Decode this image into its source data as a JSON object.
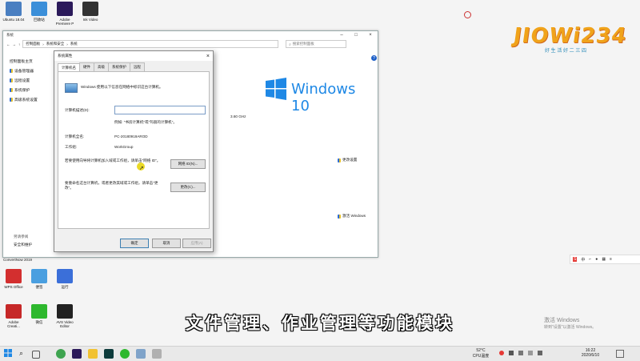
{
  "desktop": {
    "icons_top": [
      {
        "label": "Ubuntu 18.04",
        "color": "#4a7fc1"
      },
      {
        "label": "回收站",
        "color": "#3b8fd9"
      },
      {
        "label": "Adobe Premiere P",
        "color": "#2b1a5a"
      },
      {
        "label": "Ink Video",
        "color": "#333"
      }
    ],
    "icons_mid_label": "ConvertNow 2019",
    "icons_row2": [
      {
        "label": "WPS Office",
        "color": "#d32f2f"
      },
      {
        "label": "便签",
        "color": "#4a9fe0"
      },
      {
        "label": "运行",
        "color": "#3b6fd9"
      }
    ],
    "icons_row3": [
      {
        "label": "Adobe Creati...",
        "color": "#c62828"
      },
      {
        "label": "微信",
        "color": "#2eb82e"
      },
      {
        "label": "AVS Video Editor",
        "color": "#222"
      }
    ]
  },
  "explorer": {
    "title": "系统",
    "breadcrumb": [
      "控制面板",
      "系统和安全",
      "系统"
    ],
    "search_placeholder": "搜索控制面板",
    "sidebar": {
      "home": "控制面板主页",
      "items": [
        "设备管理器",
        "远程设置",
        "系统保护",
        "高级系统设置"
      ],
      "see_also": "另请参阅",
      "security": "安全和维护"
    },
    "brand": "Windows 10",
    "cpu": "3.60 GHz",
    "change_settings": "更改设置",
    "activate": "激活 Windows"
  },
  "dialog": {
    "title": "系统属性",
    "tabs": [
      "计算机名",
      "硬件",
      "高级",
      "系统保护",
      "远程"
    ],
    "info_text": "Windows 使用以下信息在网络中标识这台计算机。",
    "desc_label": "计算机描述(D):",
    "desc_value": "",
    "example": "例如: \"书房计算机\"或\"玛丽的计算机\"。",
    "fullname_label": "计算机全名:",
    "fullname_value": "PC-20180919AROD",
    "workgroup_label": "工作组:",
    "workgroup_value": "WorkGroup",
    "network_text": "若要使用向导将计算机加入域或工作组，请单击\"网络 ID\"。",
    "network_btn": "网络 ID(N)...",
    "rename_text": "要重命名这台计算机，或者更改其域或工作组，请单击\"更改\"。",
    "change_btn": "更改(C)...",
    "ok": "确定",
    "cancel": "取消",
    "apply": "应用(A)"
  },
  "watermark": {
    "logo": "JIOWi234",
    "slogan": "好 生 活 好 二 三 四",
    "activate_title": "激活 Windows",
    "activate_sub": "转到\"设置\"以激活 Windows。"
  },
  "subtitle": "文件管理、作业管理等功能模块",
  "taskbar": {
    "weather": "52°C",
    "weather_sub": "CPU温度",
    "time": "16:22",
    "date": "2020/6/10"
  }
}
